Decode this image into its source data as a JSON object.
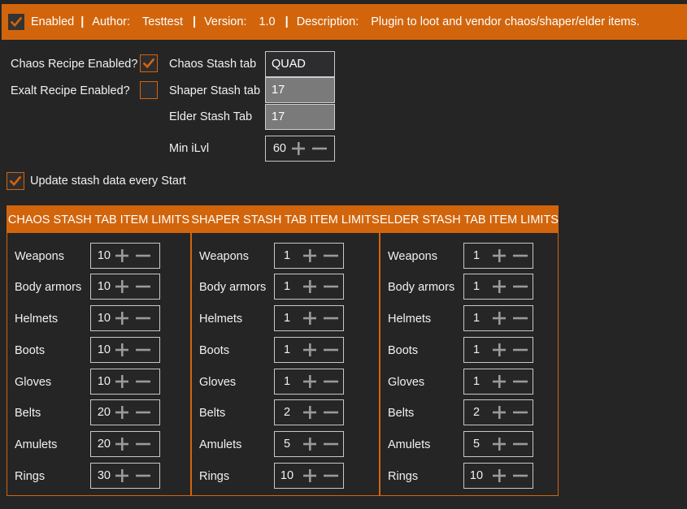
{
  "header": {
    "enabled_label": "Enabled",
    "author_label": "Author:",
    "author": "Testtest",
    "version_label": "Version:",
    "version": "1.0",
    "description_label": "Description:",
    "description": "Plugin to loot and vendor chaos/shaper/elder items.",
    "separator": "|",
    "enabled_checked": true
  },
  "settings": {
    "chaos_recipe_label": "Chaos Recipe Enabled?",
    "chaos_recipe_checked": true,
    "exalt_recipe_label": "Exalt Recipe Enabled?",
    "exalt_recipe_checked": false,
    "chaos_tab_label": "Chaos Stash tab",
    "chaos_tab_value": "QUAD",
    "shaper_tab_label": "Shaper Stash tab",
    "shaper_tab_value": "17",
    "elder_tab_label": "Elder Stash Tab",
    "elder_tab_value": "17",
    "min_ilvl_label": "Min iLvl",
    "min_ilvl_value": "60",
    "update_stash_label": "Update stash data every Start",
    "update_stash_checked": true
  },
  "panels": [
    {
      "title": "CHAOS STASH TAB ITEM LIMITS",
      "rows": [
        {
          "label": "Weapons",
          "value": "10"
        },
        {
          "label": "Body armors",
          "value": "10"
        },
        {
          "label": "Helmets",
          "value": "10"
        },
        {
          "label": "Boots",
          "value": "10"
        },
        {
          "label": "Gloves",
          "value": "10"
        },
        {
          "label": "Belts",
          "value": "20"
        },
        {
          "label": "Amulets",
          "value": "20"
        },
        {
          "label": "Rings",
          "value": "30"
        }
      ]
    },
    {
      "title": "SHAPER STASH TAB ITEM LIMITS",
      "rows": [
        {
          "label": "Weapons",
          "value": "1"
        },
        {
          "label": "Body armors",
          "value": "1"
        },
        {
          "label": "Helmets",
          "value": "1"
        },
        {
          "label": "Boots",
          "value": "1"
        },
        {
          "label": "Gloves",
          "value": "1"
        },
        {
          "label": "Belts",
          "value": "2"
        },
        {
          "label": "Amulets",
          "value": "5"
        },
        {
          "label": "Rings",
          "value": "10"
        }
      ]
    },
    {
      "title": "ELDER STASH TAB ITEM LIMITS",
      "rows": [
        {
          "label": "Weapons",
          "value": "1"
        },
        {
          "label": "Body armors",
          "value": "1"
        },
        {
          "label": "Helmets",
          "value": "1"
        },
        {
          "label": "Boots",
          "value": "1"
        },
        {
          "label": "Gloves",
          "value": "1"
        },
        {
          "label": "Belts",
          "value": "2"
        },
        {
          "label": "Amulets",
          "value": "5"
        },
        {
          "label": "Rings",
          "value": "10"
        }
      ]
    }
  ],
  "colors": {
    "accent": "#d2650c",
    "background": "#252526",
    "text": "#f1f1f1"
  },
  "icons": {
    "checkbox": "checkmark-icon",
    "increment": "plus-icon",
    "decrement": "minus-icon"
  }
}
